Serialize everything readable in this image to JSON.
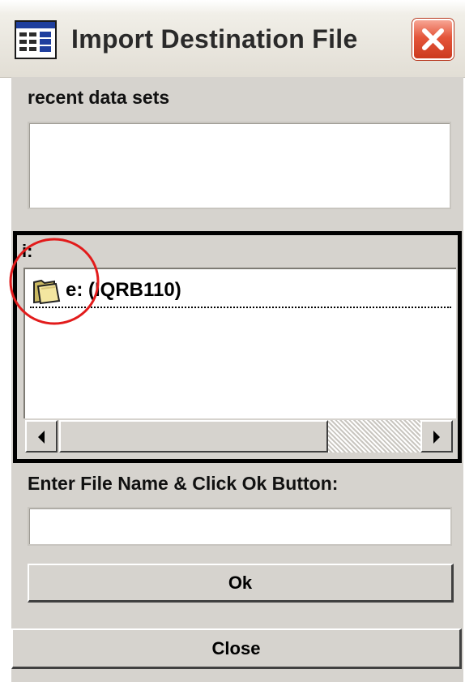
{
  "window": {
    "title": "Import Destination File",
    "icons": {
      "app": "window-grid-icon",
      "close": "close-x-icon"
    }
  },
  "recent": {
    "label": "recent data sets",
    "value": ""
  },
  "browser": {
    "current_drive": "i:",
    "items": [
      {
        "icon": "folder-icon",
        "label": "e: (IQRB110)"
      }
    ],
    "scrollbar": {
      "left_icon": "arrow-left-icon",
      "right_icon": "arrow-right-icon"
    }
  },
  "filename": {
    "label": "Enter File Name & Click Ok Button:",
    "value": ""
  },
  "buttons": {
    "ok": "Ok",
    "close": "Close"
  },
  "colors": {
    "face": "#d6d3ce",
    "close_button_red": "#e4553a",
    "annotation_red": "#e21b1b"
  }
}
